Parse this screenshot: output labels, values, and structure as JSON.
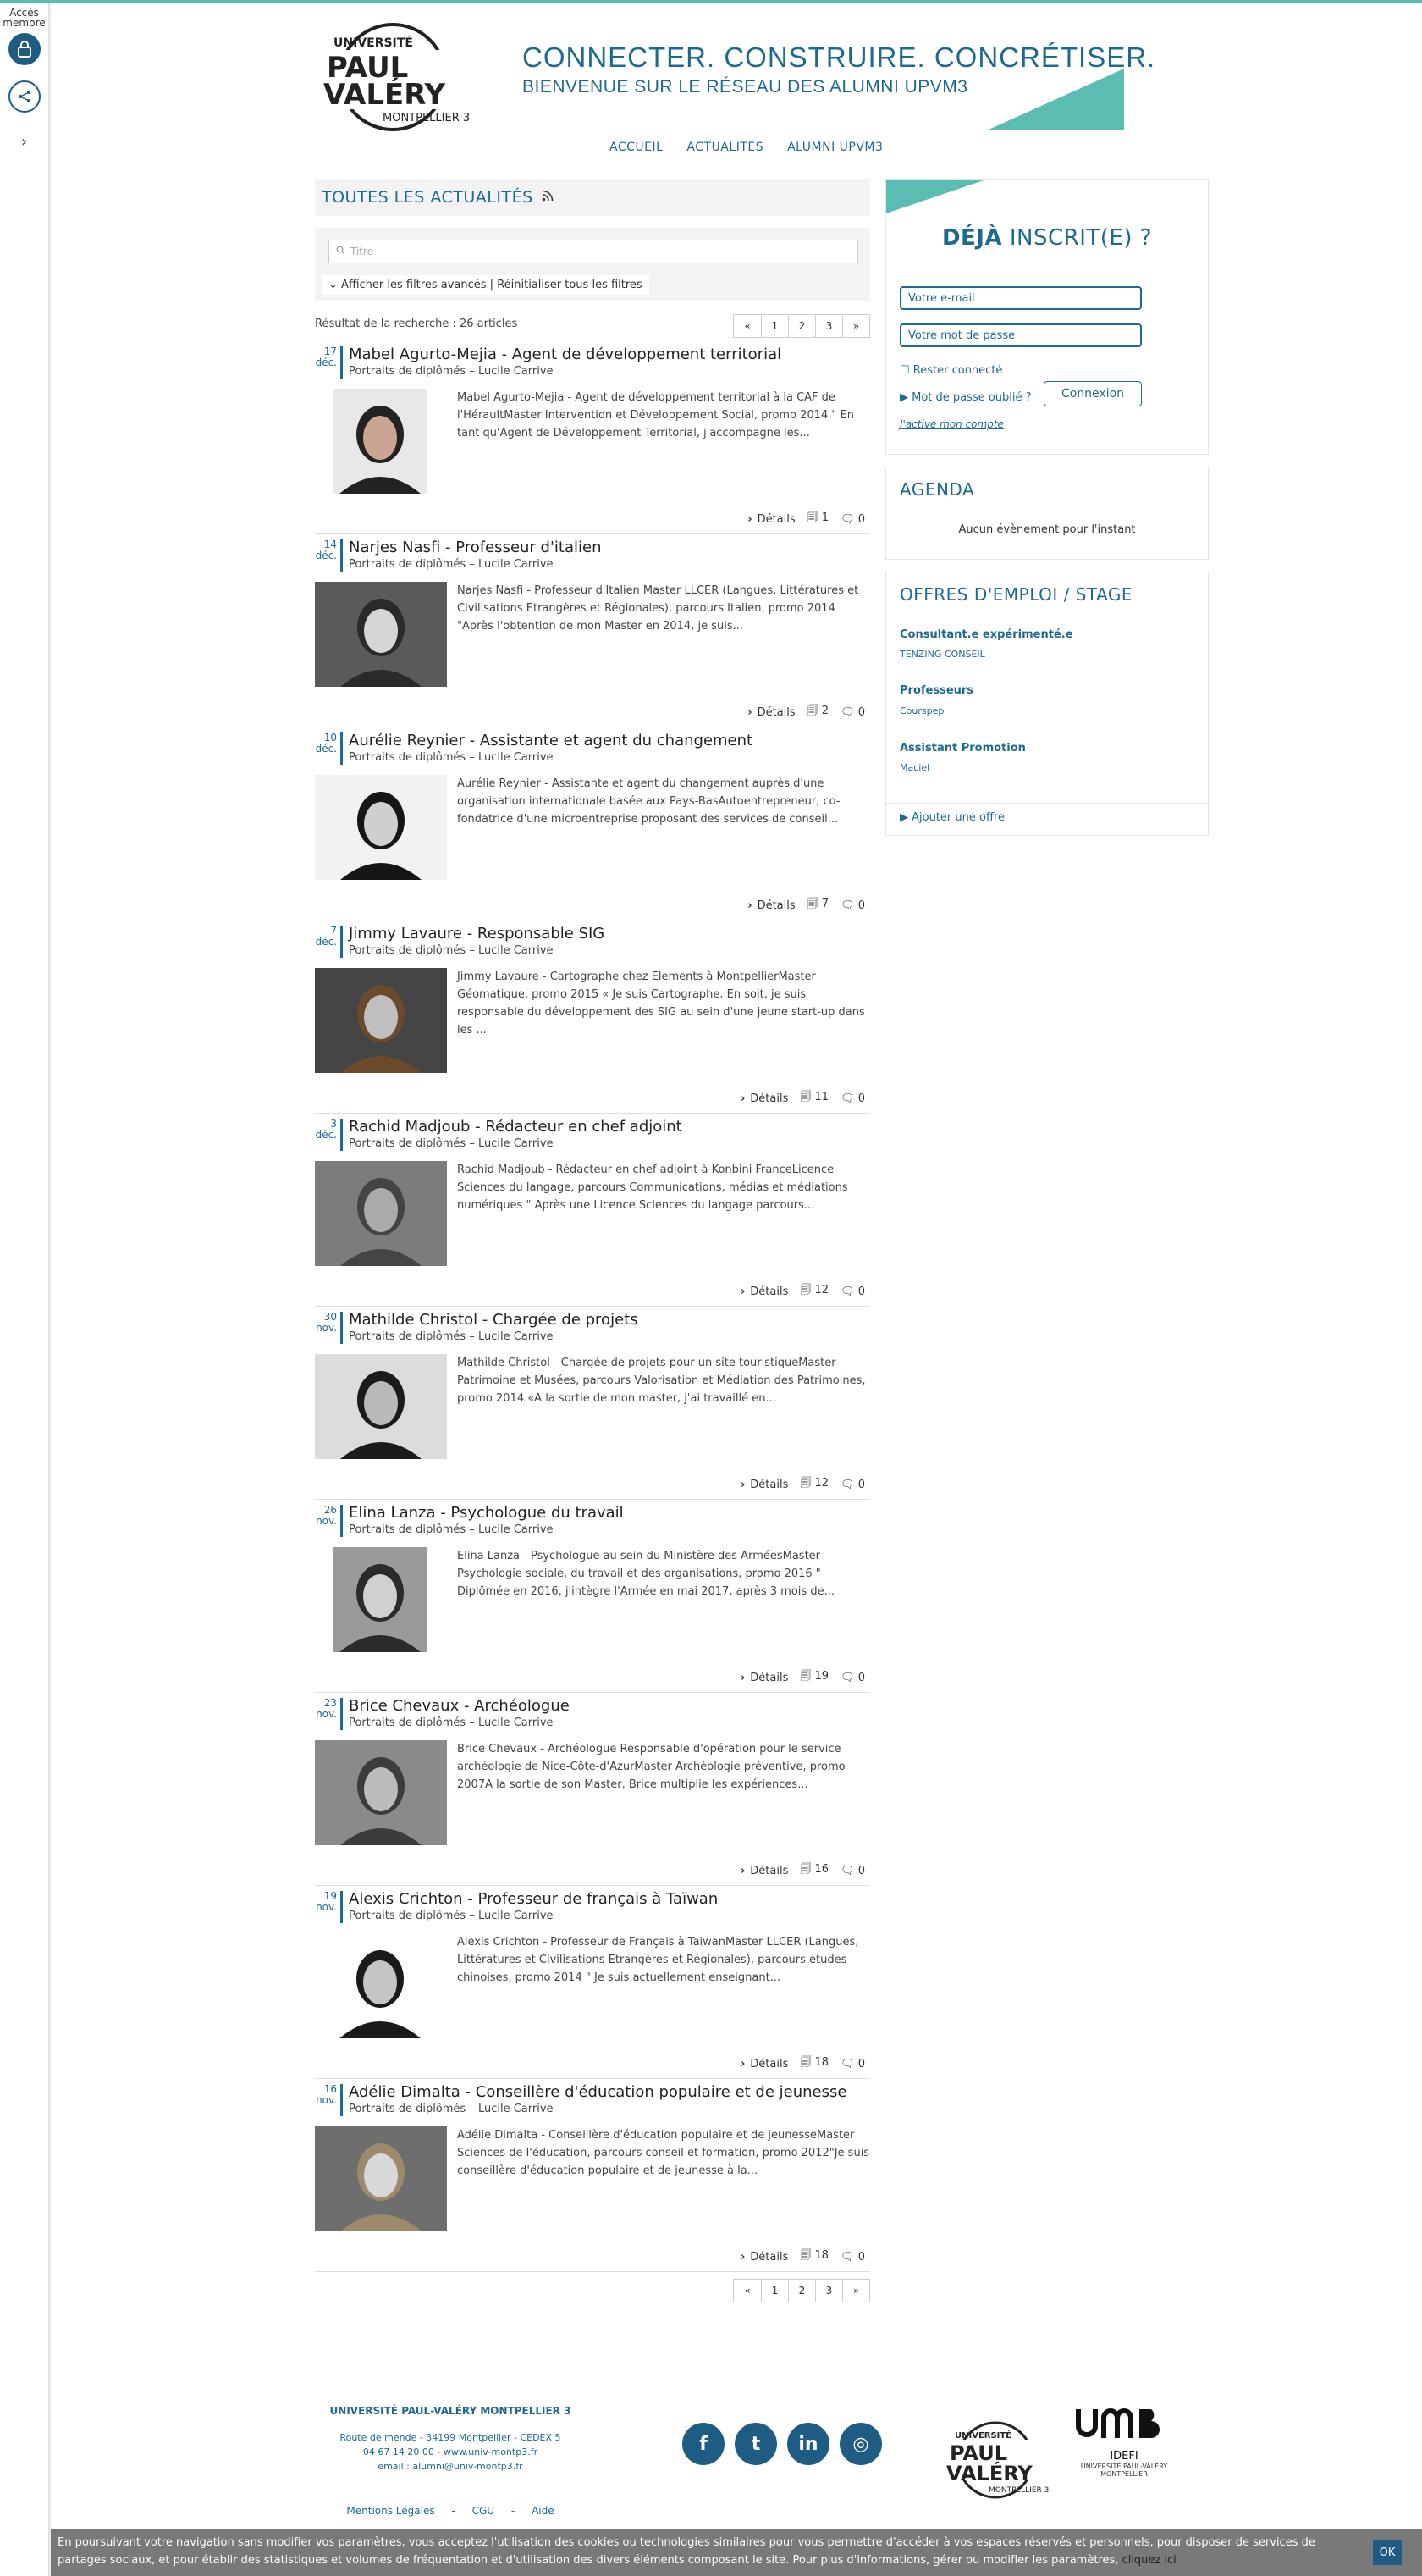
{
  "sidebar": {
    "acces_label": "Accès membre",
    "expand_label": "›"
  },
  "header": {
    "logo_top": "UNIVERSITÉ",
    "logo_paul": "PAUL",
    "logo_valery": "VALÉRY",
    "logo_city": "MONTPELLIER 3",
    "tagline": "CONNECTER. CONSTRUIRE. CONCRÉTISER.",
    "subtagline": "BIENVENUE SUR LE RÉSEAU DES ALUMNI UPVM3"
  },
  "nav": {
    "items": [
      "ACCUEIL",
      "ACTUALITÉS",
      "ALUMNI UPVM3"
    ]
  },
  "news": {
    "heading": "TOUTES LES ACTUALITÉS",
    "rss_icon": "rss-icon",
    "search_placeholder": "Titre",
    "advanced_filters": "Afficher les filtres avancés",
    "separator": "|",
    "reset_filters": "Réinitialiser tous les filtres",
    "result_text": "Résultat de la recherche : 26 articles",
    "pager": [
      "«",
      "1",
      "2",
      "3",
      "»"
    ],
    "details_label": "Détails",
    "articles": [
      {
        "day": "17",
        "month": "déc.",
        "title": "Mabel Agurto-Mejia - Agent de développement territorial",
        "category": "Portraits de diplômés",
        "author": "Lucile Carrive",
        "excerpt": "Mabel Agurto-Mejia - Agent de développement territorial à la CAF de l'HéraultMaster Intervention et Développement Social, promo 2014 \" En tant qu'Agent de Développement Territorial, j'accompagne les...",
        "views": "1",
        "comments": "0"
      },
      {
        "day": "14",
        "month": "déc.",
        "title": "Narjes Nasfi - Professeur d'italien",
        "category": "Portraits de diplômés",
        "author": "Lucile Carrive",
        "excerpt": "Narjes Nasfi - Professeur d'Italien Master LLCER (Langues, Littératures et Civilisations Etrangères et Régionales), parcours Italien, promo 2014 \"Après l'obtention de mon Master en 2014, je suis...",
        "views": "2",
        "comments": "0"
      },
      {
        "day": "10",
        "month": "déc.",
        "title": "Aurélie Reynier - Assistante et agent du changement",
        "category": "Portraits de diplômés",
        "author": "Lucile Carrive",
        "excerpt": "Aurélie Reynier - Assistante et agent du changement auprès d'une organisation internationale basée aux Pays-BasAutoentrepreneur, co-fondatrice d'une microentreprise proposant des services de conseil...",
        "views": "7",
        "comments": "0"
      },
      {
        "day": "7",
        "month": "déc.",
        "title": "Jimmy Lavaure - Responsable SIG",
        "category": "Portraits de diplômés",
        "author": "Lucile Carrive",
        "excerpt": "Jimmy Lavaure - Cartographe chez Elements à MontpellierMaster Géomatique, promo 2015 « Je suis Cartographe. En soit, je suis responsable du développement des SIG au sein d'une jeune start-up dans les ...",
        "views": "11",
        "comments": "0"
      },
      {
        "day": "3",
        "month": "déc.",
        "title": "Rachid Madjoub - Rédacteur en chef adjoint",
        "category": "Portraits de diplômés",
        "author": "Lucile Carrive",
        "excerpt": "Rachid Madjoub - Rédacteur en chef adjoint à Konbini FranceLicence Sciences du langage, parcours Communications, médias et médiations numériques \" Après une Licence Sciences du langage parcours...",
        "views": "12",
        "comments": "0"
      },
      {
        "day": "30",
        "month": "nov.",
        "title": "Mathilde Christol - Chargée de projets",
        "category": "Portraits de diplômés",
        "author": "Lucile Carrive",
        "excerpt": "Mathilde Christol - Chargée de projets pour un site touristiqueMaster Patrimoine et Musées, parcours Valorisation et Médiation des Patrimoines, promo 2014 «A la sortie de mon master, j'ai travaillé en...",
        "views": "12",
        "comments": "0"
      },
      {
        "day": "26",
        "month": "nov.",
        "title": "Elina Lanza - Psychologue du travail",
        "category": "Portraits de diplômés",
        "author": "Lucile Carrive",
        "excerpt": "Elina Lanza - Psychologue au sein du Ministère des ArméesMaster Psychologie sociale, du travail et des organisations, promo 2016 \" Diplômée en 2016, j'intègre l'Armée en mai 2017, après 3 mois de...",
        "views": "19",
        "comments": "0"
      },
      {
        "day": "23",
        "month": "nov.",
        "title": "Brice Chevaux - Archéologue",
        "category": "Portraits de diplômés",
        "author": "Lucile Carrive",
        "excerpt": "Brice Chevaux - Archéologue Responsable d'opération pour le service archéologie de Nice-Côte-d'AzurMaster Archéologie préventive, promo 2007A la sortie de son Master, Brice multiplie les expériences...",
        "views": "16",
        "comments": "0"
      },
      {
        "day": "19",
        "month": "nov.",
        "title": "Alexis Crichton - Professeur de français à Taïwan",
        "category": "Portraits de diplômés",
        "author": "Lucile Carrive",
        "excerpt": "Alexis Crichton - Professeur de Français à TaiwanMaster LLCER (Langues, Littératures et Civilisations Etrangères et Régionales), parcours études chinoises, promo 2014 \" Je suis actuellement enseignant...",
        "views": "18",
        "comments": "0"
      },
      {
        "day": "16",
        "month": "nov.",
        "title": "Adélie Dimalta - Conseillère d'éducation populaire et de jeunesse",
        "category": "Portraits de diplômés",
        "author": "Lucile Carrive",
        "excerpt": "Adélie Dimalta - Conseillère d'éducation populaire et de jeunesseMaster Sciences de l'éducation, parcours conseil et formation, promo 2012\"Je suis conseillère d'éducation populaire et de jeunesse à la...",
        "views": "18",
        "comments": "0"
      }
    ]
  },
  "login": {
    "heading_bold": "DÉJÀ",
    "heading_rest": "INSCRIT(E) ?",
    "email_placeholder": "Votre e-mail",
    "password_placeholder": "Votre mot de passe",
    "remember_label": "Rester connecté",
    "forgot_label": "Mot de passe oublié ?",
    "submit_label": "Connexion",
    "activate_label": "J'active mon compte"
  },
  "agenda": {
    "heading": "AGENDA",
    "empty_text": "Aucun évènement pour l'instant"
  },
  "offers": {
    "heading": "OFFRES D'EMPLOI / STAGE",
    "items": [
      {
        "title": "Consultant.e expérimenté.e",
        "company": "TENZING CONSEIL"
      },
      {
        "title": "Professeurs",
        "company": "Courspep"
      },
      {
        "title": "Assistant Promotion",
        "company": "Maciel"
      }
    ],
    "add_label": "Ajouter une offre"
  },
  "footer": {
    "univ_name": "UNIVERSITÉ PAUL-VALÉRY MONTPELLIER 3",
    "address": "Route de mende - 34199 Montpellier - CEDEX 5",
    "phone": "04 67 14 20 00 - www.univ-montp3.fr",
    "email": "email : alumni@univ-montp3.fr",
    "links": [
      "Mentions Légales",
      "CGU",
      "Aide"
    ],
    "link_sep": "-",
    "social": [
      "f",
      "t",
      "in",
      "◎"
    ],
    "idefi_label": "IDEFI",
    "idefi_sub": "UNIVERSITÉ PAUL-VALÉRY MONTPELLIER"
  },
  "cookie": {
    "text": "En poursuivant votre navigation sans modifier vos paramètres, vous acceptez l'utilisation des cookies ou technologies similaires pour vous permettre d'accéder à vos espaces réservés et personnels, pour disposer de services de partages sociaux, et pour établir des statistiques et volumes de fréquentation et d'utilisation des divers éléments composant le site. Pour plus d'informations, gérer ou modifier les paramètres,",
    "link_label": "cliquez ici",
    "ok_label": "OK"
  },
  "colors": {
    "primary": "#1e6a8e",
    "accent": "#5bbdb2",
    "dark_blue": "#1e5c83"
  }
}
